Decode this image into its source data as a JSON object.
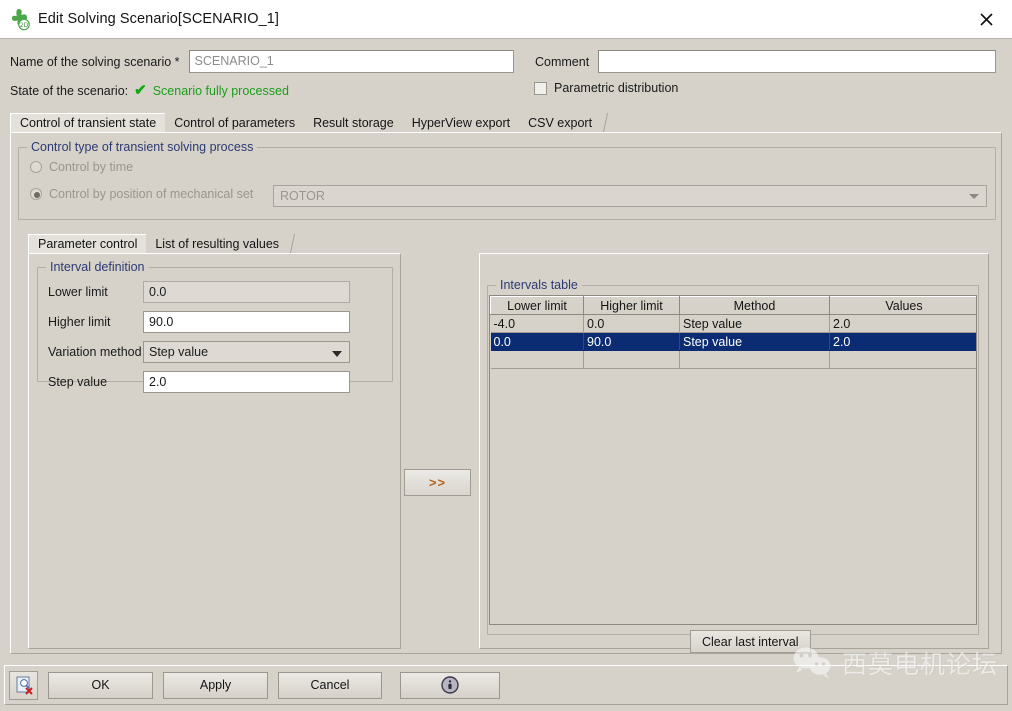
{
  "window": {
    "title": "Edit Solving Scenario[SCENARIO_1]",
    "icon": "flux2d-icon",
    "close_label": "✕"
  },
  "form": {
    "name_label": "Name of the solving scenario *",
    "name_value": "SCENARIO_1",
    "comment_label": "Comment",
    "comment_value": "",
    "comment_placeholder": "",
    "state_label": "State of the scenario:",
    "state_check": "✔",
    "state_value": "Scenario fully processed",
    "parametric_label": "Parametric distribution",
    "parametric_checked": false
  },
  "tabs": [
    {
      "label": "Control of transient state",
      "active": true
    },
    {
      "label": "Control of parameters",
      "active": false
    },
    {
      "label": "Result storage",
      "active": false
    },
    {
      "label": "HyperView export",
      "active": false
    },
    {
      "label": "CSV export",
      "active": false
    }
  ],
  "control_group": {
    "title": "Control type of transient solving process",
    "radio_time_label": "Control by time",
    "radio_time_selected": false,
    "radio_position_label": "Control by position of mechanical set",
    "radio_position_selected": true,
    "mechanical_set_value": "ROTOR"
  },
  "subtabs": [
    {
      "label": "Parameter control",
      "active": true
    },
    {
      "label": "List of resulting values",
      "active": false
    }
  ],
  "interval_definition": {
    "title": "Interval definition",
    "fields": [
      {
        "label": "Lower limit",
        "value": "0.0",
        "readonly": true,
        "type": "text"
      },
      {
        "label": "Higher limit",
        "value": "90.0",
        "readonly": false,
        "type": "text"
      },
      {
        "label": "Variation method",
        "value": "Step value",
        "readonly": false,
        "type": "combo"
      },
      {
        "label": "Step value",
        "value": "2.0",
        "readonly": false,
        "type": "text"
      }
    ]
  },
  "transfer_button": {
    "label": ">>"
  },
  "intervals_table": {
    "title": "Intervals table",
    "columns": [
      "Lower limit",
      "Higher limit",
      "Method",
      "Values"
    ],
    "rows": [
      {
        "cells": [
          "-4.0",
          "0.0",
          "Step value",
          "2.0"
        ],
        "selected": false
      },
      {
        "cells": [
          "0.0",
          "90.0",
          "Step value",
          "2.0"
        ],
        "selected": true
      },
      {
        "cells": [
          "",
          "",
          "",
          ""
        ],
        "selected": false
      }
    ],
    "clear_button": "Clear last interval"
  },
  "buttonbar": {
    "icon_name": "delete-scenario-icon",
    "buttons": [
      {
        "label": "OK"
      },
      {
        "label": "Apply"
      },
      {
        "label": "Cancel"
      }
    ],
    "info_button_icon": "info-icon"
  },
  "watermark": {
    "icon": "wechat-icon",
    "text": "西莫电机论坛"
  },
  "colors": {
    "surface": "#d6d2ca",
    "group_title": "#2c3a72",
    "status_green": "#1a9e1a",
    "selection_blue": "#0b2c72",
    "transfer_orange": "#b5651d"
  }
}
